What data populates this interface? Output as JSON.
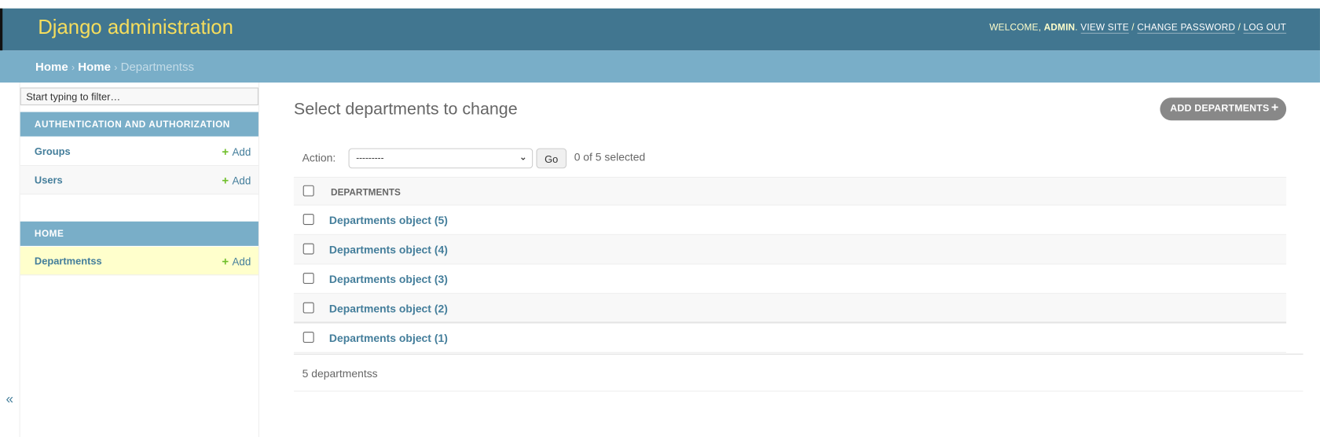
{
  "header": {
    "title": "Django administration",
    "welcome": "Welcome,",
    "user": "admin",
    "view_site": "View site",
    "change_password": "Change password",
    "log_out": "Log out"
  },
  "breadcrumbs": {
    "items": [
      "Home",
      "Home"
    ],
    "current": "Departmentss",
    "sep": "›"
  },
  "sidebar": {
    "filter_placeholder": "Start typing to filter…",
    "toggle": "«",
    "add_label": "Add",
    "modules": [
      {
        "caption": "Authentication and Authorization",
        "models": [
          "Groups",
          "Users"
        ]
      },
      {
        "caption": "Home",
        "models": [
          "Departmentss"
        ]
      }
    ]
  },
  "main": {
    "title": "Select departments to change",
    "add_button": "Add departments",
    "add_icon": "+",
    "action_label": "Action:",
    "action_value": "---------",
    "go": "Go",
    "counter": "0 of 5 selected",
    "column": "Departments",
    "rows": [
      "Departments object (5)",
      "Departments object (4)",
      "Departments object (3)",
      "Departments object (2)",
      "Departments object (1)"
    ],
    "paginator": "5 departmentss"
  }
}
